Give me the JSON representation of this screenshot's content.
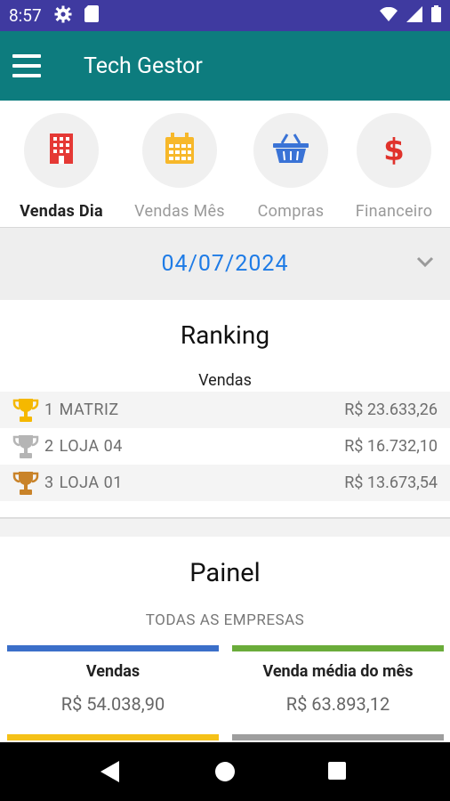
{
  "status_bar": {
    "time": "8:57",
    "icons_left": [
      "gear-icon",
      "sd-card-icon"
    ],
    "icons_right": [
      "wifi-icon",
      "signal-icon",
      "battery-icon"
    ]
  },
  "app_bar": {
    "title": "Tech Gestor",
    "menu_icon": "hamburger-menu-icon"
  },
  "tabs": [
    {
      "label": "Vendas Dia",
      "icon": "building-icon",
      "active": true,
      "color": "#e53935"
    },
    {
      "label": "Vendas Mês",
      "icon": "calendar-icon",
      "active": false,
      "color": "#f7b82a"
    },
    {
      "label": "Compras",
      "icon": "basket-icon",
      "active": false,
      "color": "#3a73d6"
    },
    {
      "label": "Financeiro",
      "icon": "dollar-icon",
      "active": false,
      "color": "#e0322b"
    }
  ],
  "date_selector": {
    "value": "04/07/2024",
    "icon": "chevron-down-icon"
  },
  "ranking": {
    "title": "Ranking",
    "subtitle": "Vendas",
    "rows": [
      {
        "position": "1",
        "name": "MATRIZ",
        "value": "R$ 23.633,26",
        "trophy_color": "#f5b800"
      },
      {
        "position": "2",
        "name": "LOJA 04",
        "value": "R$ 16.732,10",
        "trophy_color": "#b5b5b5"
      },
      {
        "position": "3",
        "name": "LOJA 01",
        "value": "R$ 13.673,54",
        "trophy_color": "#c98329"
      }
    ]
  },
  "panel": {
    "title": "Painel",
    "subtitle": "TODAS AS EMPRESAS",
    "cards": [
      {
        "label": "Vendas",
        "value": "R$ 54.038,90",
        "color": "#3b6fc9"
      },
      {
        "label": "Venda média do mês",
        "value": "R$ 63.893,12",
        "color": "#6aac3a"
      },
      {
        "label": "",
        "value": "",
        "color": "#f5c118"
      },
      {
        "label": "",
        "value": "",
        "color": "#9e9e9e"
      }
    ]
  },
  "nav_bar": {
    "icons": [
      "back-icon",
      "home-icon",
      "recents-icon"
    ]
  }
}
